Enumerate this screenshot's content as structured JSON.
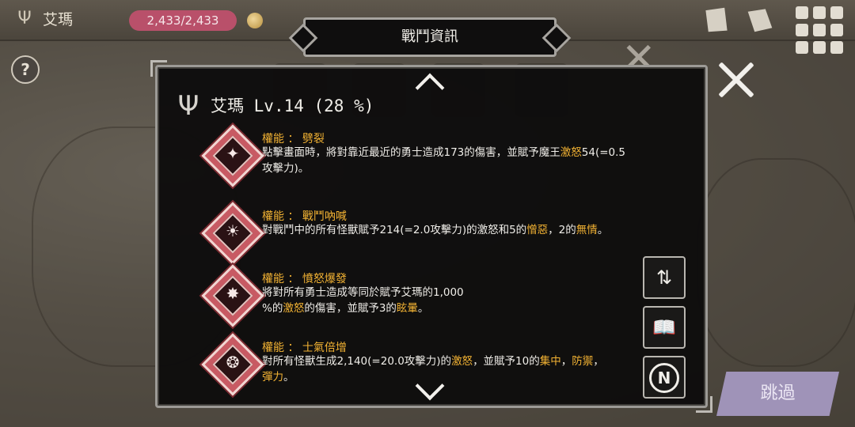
{
  "topbar": {
    "player_name": "艾瑪",
    "hp_text": "2,433/2,433",
    "icons": [
      "trident-icon",
      "coin-icon",
      "book-icon",
      "scroll-icon",
      "grid-menu-icon"
    ]
  },
  "help": {
    "label": "?"
  },
  "skip": {
    "label": "跳過"
  },
  "dialog": {
    "title": "戰鬥資訊",
    "header": {
      "name": "艾瑪",
      "level": "Lv.14 (28 %)"
    },
    "skills": [
      {
        "title": "權能 ： 劈裂",
        "desc_parts": [
          {
            "t": "點擊畫面時，將對靠近最近的勇士造成173的傷害，並賦予魔王"
          },
          {
            "t": "激怒",
            "hl": true
          },
          {
            "t": "54(=0.5攻擊力)。"
          }
        ],
        "glyph": "✦"
      },
      {
        "title": "權能 ： 戰鬥吶喊",
        "desc_parts": [
          {
            "t": "對戰鬥中的所有怪獸賦予214(=2.0攻擊力)的激怒和5的"
          },
          {
            "t": "憎惡",
            "hl": true
          },
          {
            "t": "，2的"
          },
          {
            "t": "無情",
            "hl": true
          },
          {
            "t": "。"
          }
        ],
        "glyph": "☀"
      },
      {
        "title": "權能 ： 憤怒爆發",
        "desc_parts": [
          {
            "t": "將對所有勇士造成等同於賦予艾瑪的1,000\n%的"
          },
          {
            "t": "激怒",
            "hl": true
          },
          {
            "t": "的傷害，並賦予3的"
          },
          {
            "t": "眩暈",
            "hl": true
          },
          {
            "t": "。"
          }
        ],
        "glyph": "✸"
      },
      {
        "title": "權能 ： 士氣倍增",
        "desc_parts": [
          {
            "t": "對所有怪獸生成2,140(=20.0攻擊力)的"
          },
          {
            "t": "激怒",
            "hl": true
          },
          {
            "t": "，並賦予10的"
          },
          {
            "t": "集中",
            "hl": true
          },
          {
            "t": "，"
          },
          {
            "t": "防禦",
            "hl": true
          },
          {
            "t": "，\n"
          },
          {
            "t": "彈力",
            "hl": true
          },
          {
            "t": "。"
          }
        ],
        "glyph": "❂"
      }
    ]
  },
  "side_buttons": [
    {
      "name": "sort-arrows-button",
      "glyph": "⇅"
    },
    {
      "name": "open-book-button",
      "glyph": "📖"
    },
    {
      "name": "n-badge-button",
      "glyph": "N"
    }
  ],
  "colors": {
    "highlight": "#f2b233",
    "hp_pill": "#b9506a",
    "skip_btn": "#9f93b8",
    "skill_icon": "#c85a63"
  }
}
